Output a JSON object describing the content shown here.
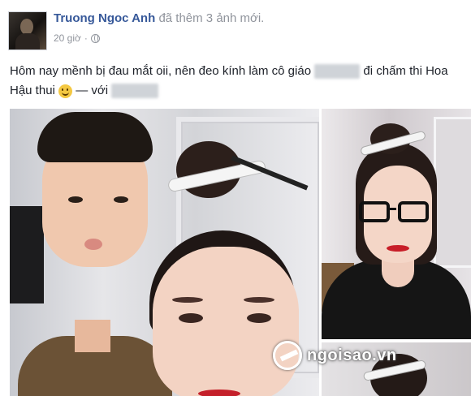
{
  "post": {
    "author": "Truong Ngoc Anh",
    "action": "đã thêm 3 ảnh mới.",
    "time": "20 giờ",
    "audience_icon": "globe-icon",
    "text_part1": "Hôm nay mềnh bị đau mắt oii, nên đeo kính làm cô giáo",
    "text_part2": "đi chấm thi Hoa Hậu thui",
    "with_label": "— với",
    "emoji": "smile-emoji"
  },
  "photos": [
    {
      "name": "photo-1"
    },
    {
      "name": "photo-2"
    },
    {
      "name": "photo-3"
    }
  ],
  "watermark": {
    "text": "ngoisao.vn"
  }
}
